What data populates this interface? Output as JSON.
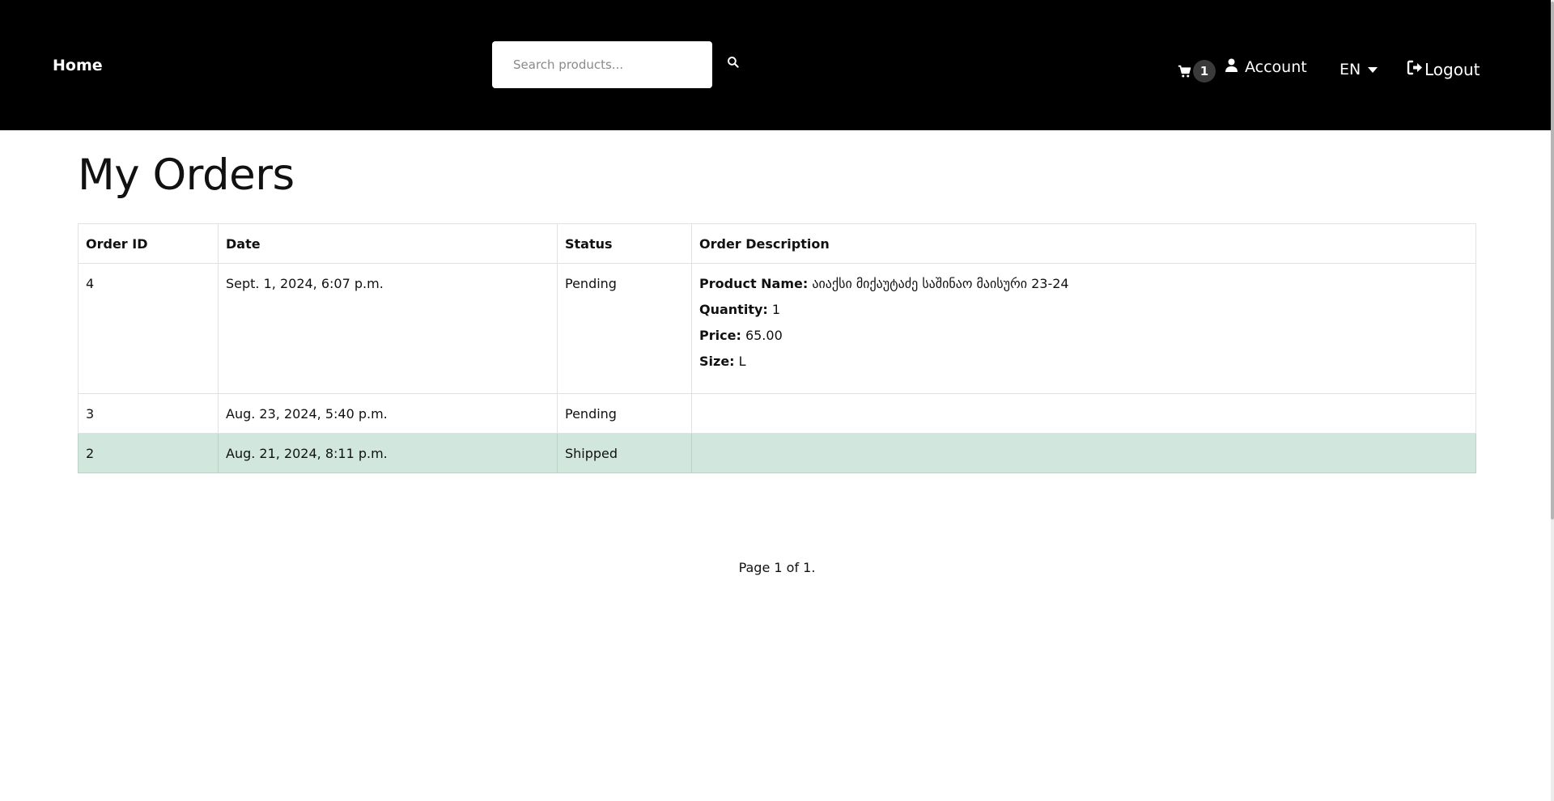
{
  "header": {
    "home_label": "Home",
    "search_placeholder": "Search products...",
    "cart_count": "1",
    "account_label": "Account",
    "language_label": "EN",
    "logout_label": "Logout",
    "icons": [
      "search-icon",
      "cart-icon",
      "user-icon",
      "chevron-down-icon",
      "logout-icon"
    ]
  },
  "page": {
    "title": "My Orders"
  },
  "table": {
    "headers": [
      "Order ID",
      "Date",
      "Status",
      "Order Description"
    ],
    "rows": [
      {
        "order_id": "4",
        "date": "Sept. 1, 2024, 6:07 p.m.",
        "status": "Pending",
        "description": {
          "product_name_label": "Product Name:",
          "product_name": "აიაქსი მიქაუტაძე საშინაო მაისური 23-24",
          "quantity_label": "Quantity:",
          "quantity": "1",
          "price_label": "Price:",
          "price": "65.00",
          "size_label": "Size:",
          "size": "L"
        }
      },
      {
        "order_id": "3",
        "date": "Aug. 23, 2024, 5:40 p.m.",
        "status": "Pending"
      },
      {
        "order_id": "2",
        "date": "Aug. 21, 2024, 8:11 p.m.",
        "status": "Shipped",
        "highlight_color": "#d1e7dd"
      }
    ]
  },
  "pagination": {
    "text": "Page 1 of 1."
  },
  "colors": {
    "header_bg": "#000000",
    "badge_bg": "#3a3a3a",
    "shipped_row_bg": "#d1e7dd"
  }
}
